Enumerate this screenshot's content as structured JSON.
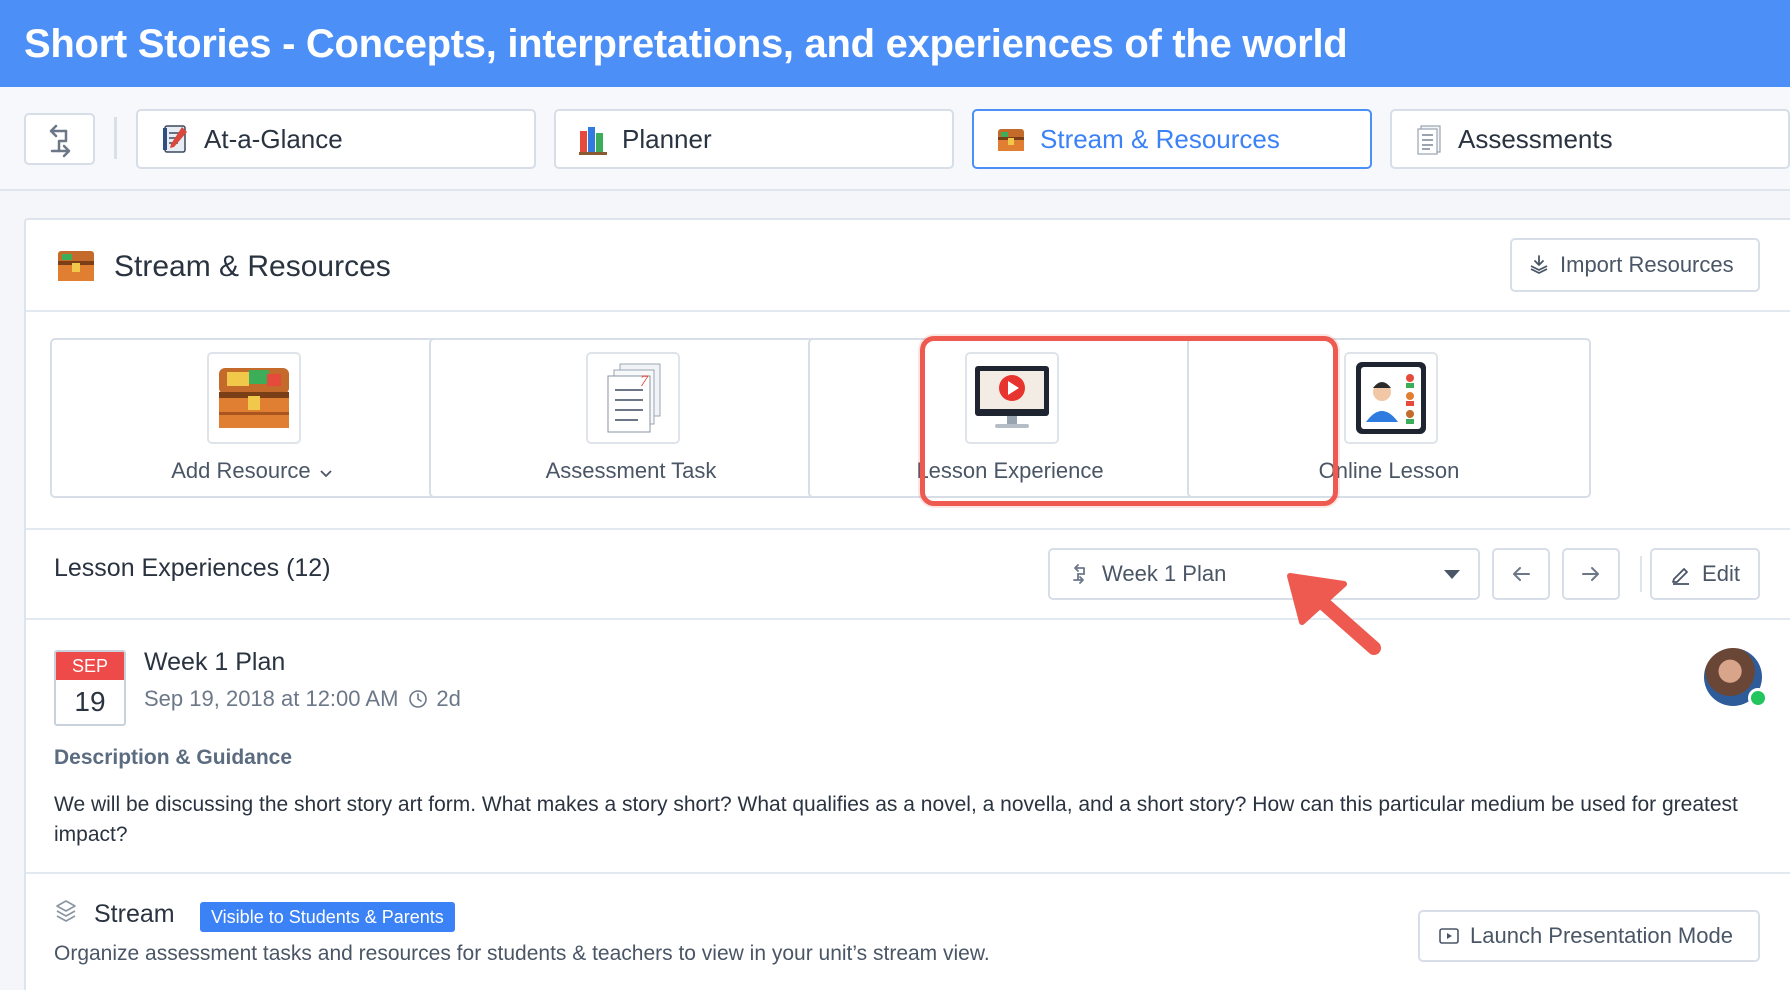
{
  "header": {
    "title": "Short Stories - Concepts, interpretations, and experiences of the world"
  },
  "tabs": [
    {
      "label": "At-a-Glance",
      "icon": "notebook-icon"
    },
    {
      "label": "Planner",
      "icon": "books-icon"
    },
    {
      "label": "Stream & Resources",
      "icon": "treasure-chest-icon",
      "active": true
    },
    {
      "label": "Assessments",
      "icon": "document-icon"
    }
  ],
  "panel": {
    "title": "Stream & Resources",
    "import_label": "Import Resources"
  },
  "resource_cards": [
    {
      "label": "Add Resource",
      "has_dropdown": true
    },
    {
      "label": "Assessment Task"
    },
    {
      "label": "Lesson Experience",
      "highlighted": true
    },
    {
      "label": "Online Lesson"
    }
  ],
  "lesson_experiences": {
    "title": "Lesson Experiences (12)",
    "selected_plan": "Week 1 Plan",
    "edit_label": "Edit"
  },
  "plan": {
    "month": "SEP",
    "day": "19",
    "title": "Week 1 Plan",
    "date": "Sep 19, 2018 at 12:00 AM",
    "duration": "2d"
  },
  "description": {
    "label": "Description & Guidance",
    "text": "We will be discussing the short story art form. What makes a story short? What qualifies as a novel, a novella, and a short story? How can this particular medium be used for greatest impact?"
  },
  "stream": {
    "title": "Stream",
    "badge": "Visible to Students & Parents",
    "subtitle": "Organize assessment tasks and resources for students & teachers to view in your unit’s stream view.",
    "launch_label": "Launch Presentation Mode"
  },
  "colors": {
    "header_bg": "#4b8ff7",
    "accent": "#3b82f6",
    "highlight": "#ee5a4f",
    "date_red": "#ef4a4a",
    "online": "#22c55e"
  }
}
